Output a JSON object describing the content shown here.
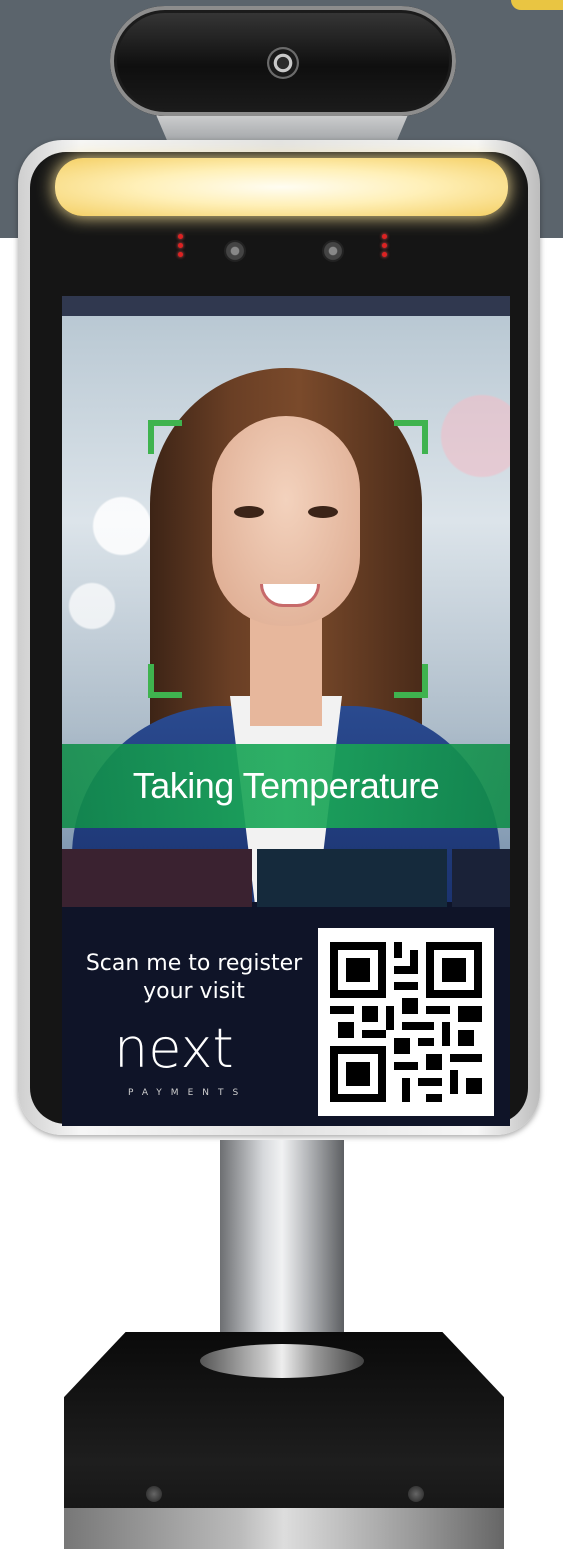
{
  "screen": {
    "status_text": "Taking Temperature",
    "promo_text": "Scan me to register your visit",
    "logo_text": "next",
    "logo_subtext": "PAYMENTS"
  },
  "colors": {
    "wall": "#5b646c",
    "status_banner": "#1caa5a",
    "face_frame": "#3fb34f",
    "screen_bg": "#0f1428",
    "logo_chip": "#e4c24a"
  },
  "icons": [
    "camera-lens-icon",
    "sensor-icon",
    "qr-code-icon"
  ]
}
